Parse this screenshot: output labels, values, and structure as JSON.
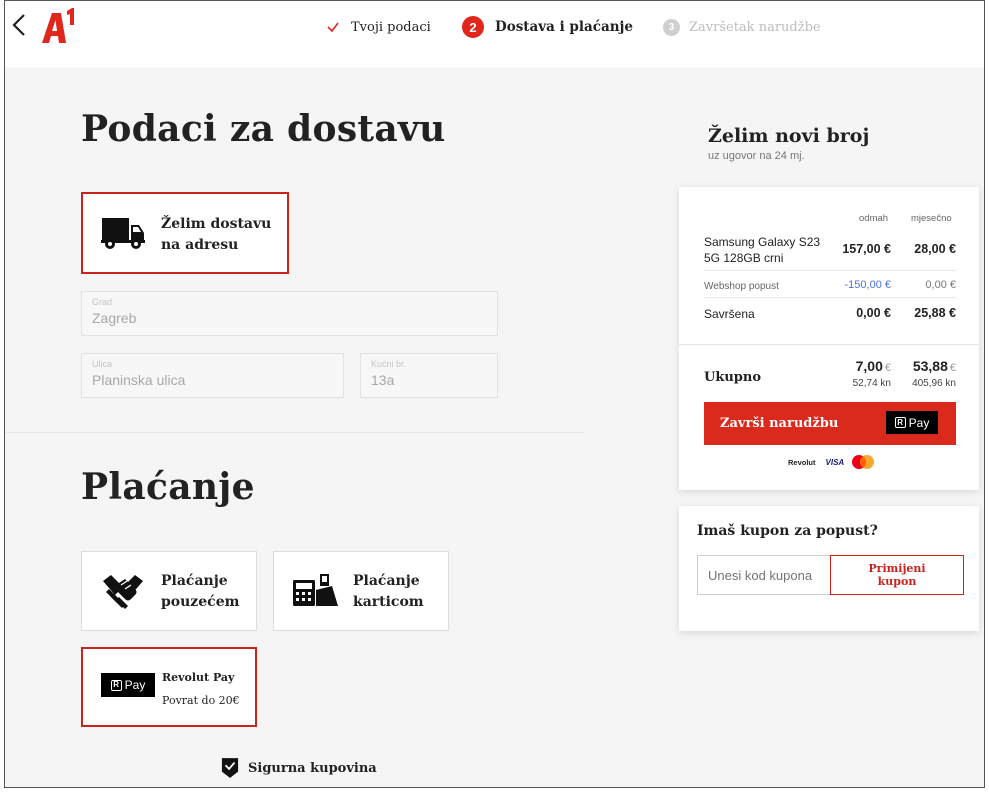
{
  "header": {
    "steps": [
      {
        "label": "Tvoji podaci",
        "state": "done"
      },
      {
        "number": "2",
        "label": "Dostava i plaćanje",
        "state": "active"
      },
      {
        "number": "3",
        "label": "Završetak narudžbe",
        "state": "upcoming"
      }
    ],
    "logo_text": "A1"
  },
  "delivery": {
    "title": "Podaci za dostavu",
    "option_label_line1": "Želim dostavu",
    "option_label_line2": "na adresu",
    "fields": {
      "city": {
        "label": "Grad",
        "value": "Zagreb"
      },
      "street": {
        "label": "Ulica",
        "value": "Planinska ulica"
      },
      "house_number": {
        "label": "Kućni br.",
        "value": "13a"
      }
    }
  },
  "payment": {
    "title": "Plaćanje",
    "options": [
      {
        "line1": "Plaćanje",
        "line2": "pouzećem"
      },
      {
        "line1": "Plaćanje",
        "line2": "karticom"
      }
    ],
    "revolut": {
      "title": "Revolut Pay",
      "subtitle": "Povrat do 20€",
      "badge": "Pay",
      "badge_mark": "R"
    }
  },
  "secure_label": "Sigurna kupovina",
  "summary": {
    "title": "Želim novi broj",
    "subtitle": "uz ugovor na 24 mj.",
    "col_now": "odmah",
    "col_monthly": "mjesečno",
    "rows": [
      {
        "label_line1": "Samsung Galaxy S23",
        "label_line2": "5G 128GB crni",
        "now": "157,00 €",
        "monthly": "28,00 €"
      },
      {
        "label_line1": "Webshop popust",
        "now": "-150,00 €",
        "monthly": "0,00 €"
      },
      {
        "label_line1": "Savršena",
        "now": "0,00 €",
        "monthly": "25,88 €"
      }
    ],
    "total_label": "Ukupno",
    "total_now": "7,00",
    "total_monthly": "53,88",
    "currency": "€",
    "total_now_kn": "52,74 kn",
    "total_monthly_kn": "405,96 kn",
    "cta_label": "Završi narudžbu",
    "cta_badge": "Pay",
    "cta_badge_mark": "R",
    "payment_methods": [
      "Revolut",
      "VISA"
    ]
  },
  "coupon": {
    "title": "Imaš kupon za popust?",
    "placeholder": "Unesi kod kupona",
    "button_line1": "Primijeni",
    "button_line2": "kupon"
  },
  "colors": {
    "brand_red": "#da2a1d",
    "border_red": "#c8231c",
    "discount_blue": "#4c6ee0"
  }
}
